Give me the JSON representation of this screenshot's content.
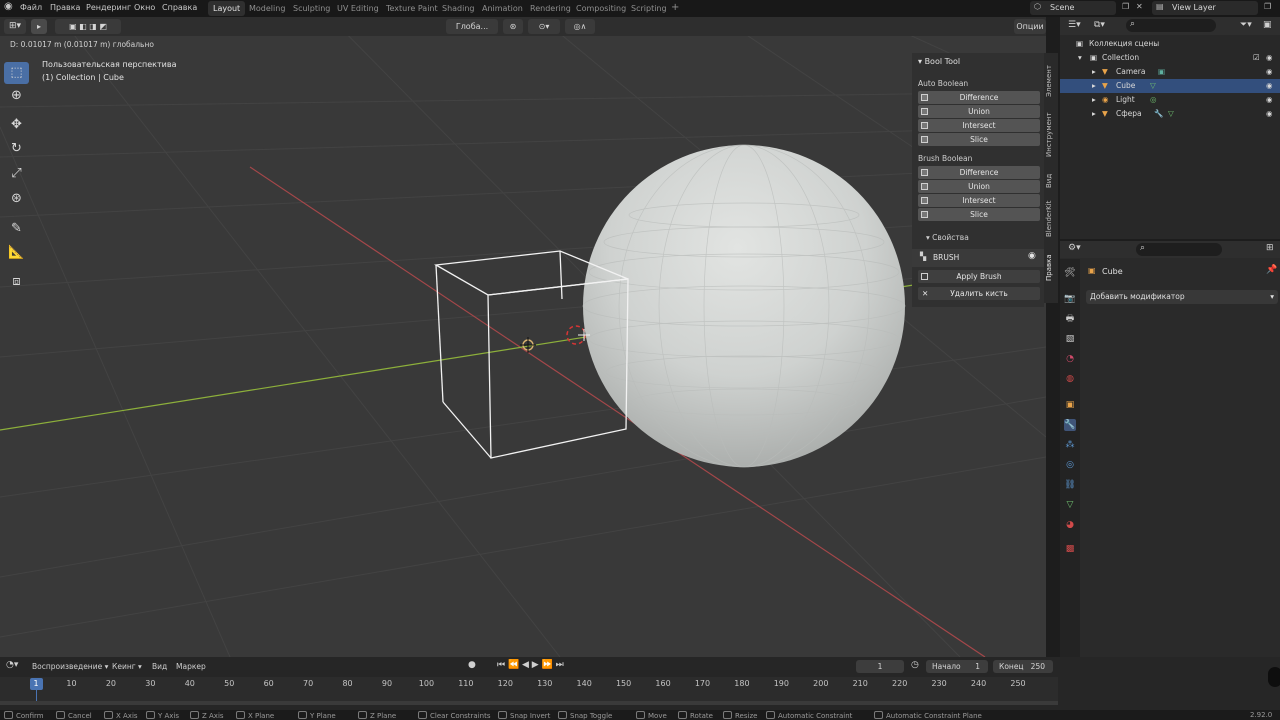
{
  "menu": {
    "items": [
      "Файл",
      "Правка",
      "Рендеринг",
      "Окно",
      "Справка"
    ],
    "workspaces": [
      "Layout",
      "Modeling",
      "Sculpting",
      "UV Editing",
      "Texture Paint",
      "Shading",
      "Animation",
      "Rendering",
      "Compositing",
      "Scripting"
    ],
    "active_workspace": "Layout",
    "add_tab": "+",
    "scene": "Scene",
    "view_layer": "View Layer"
  },
  "viewport_header": {
    "orientation": "Глоба...",
    "options": "Опции",
    "status_text": "D: 0.01017 m (0.01017 m) глобально"
  },
  "viewport": {
    "perspective": "Пользовательская перспектива",
    "collection_line": "(1) Collection | Cube"
  },
  "npanel": {
    "title": "Bool Tool",
    "auto_boolean": "Auto Boolean",
    "auto_buttons": [
      "Difference",
      "Union",
      "Intersect",
      "Slice"
    ],
    "brush_boolean": "Brush Boolean",
    "brush_buttons": [
      "Difference",
      "Union",
      "Intersect",
      "Slice"
    ],
    "properties": "Свойства",
    "brush_label": "BRUSH",
    "apply_brush": "Apply Brush",
    "delete_brush": "Удалить кисть"
  },
  "side_tabs": [
    "Элемент",
    "Инструмент",
    "Вид",
    "BlenderKit",
    "Правка"
  ],
  "outliner": {
    "scene_collection": "Коллекция сцены",
    "rows": [
      {
        "name": "Collection",
        "selected": false
      },
      {
        "name": "Camera",
        "selected": false
      },
      {
        "name": "Cube",
        "selected": true
      },
      {
        "name": "Light",
        "selected": false
      },
      {
        "name": "Сфера",
        "selected": false
      }
    ]
  },
  "properties": {
    "object_name": "Cube",
    "add_modifier": "Добавить модификатор"
  },
  "timeline": {
    "playback": "Воспроизведение",
    "keying": "Кеинг",
    "view": "Вид",
    "marker": "Маркер",
    "current_frame": "1",
    "start_label": "Начало",
    "start": "1",
    "end_label": "Конец",
    "end": "250",
    "frame_labels": [
      "1",
      "10",
      "20",
      "30",
      "40",
      "50",
      "60",
      "70",
      "80",
      "90",
      "100",
      "110",
      "120",
      "130",
      "140",
      "150",
      "160",
      "170",
      "180",
      "190",
      "200",
      "210",
      "220",
      "230",
      "240",
      "250"
    ]
  },
  "statusbar": {
    "items": [
      "Confirm",
      "Cancel",
      "X Axis",
      "Y Axis",
      "Z Axis",
      "X Plane",
      "Y Plane",
      "Z Plane",
      "Clear Constraints",
      "Snap Invert",
      "Snap Toggle",
      "Move",
      "Rotate",
      "Resize",
      "Automatic Constraint",
      "Automatic Constraint Plane"
    ],
    "version": "2.92.0"
  },
  "colors": {
    "selection_blue": "#334f7d",
    "tool_active": "#4a6fa5",
    "x_axis_red": "#b44b4b",
    "y_axis_green": "#8fb03a",
    "viewport_bg": "#393939"
  }
}
